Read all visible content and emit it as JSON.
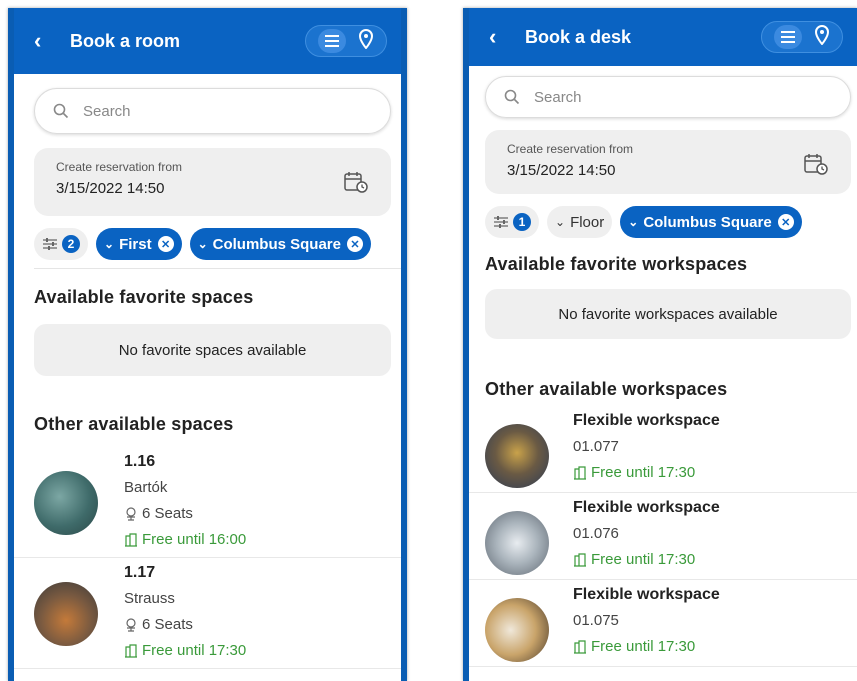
{
  "left": {
    "title": "Book a room",
    "search_placeholder": "Search",
    "date_label": "Create reservation from",
    "date_value": "3/15/2022 14:50",
    "filter_count": "2",
    "chips": [
      "First",
      "Columbus Square"
    ],
    "favorites_title": "Available favorite spaces",
    "favorites_empty": "No favorite spaces available",
    "other_title": "Other available spaces",
    "items": [
      {
        "name": "1.16",
        "sub": "Bartók",
        "seats": "6 Seats",
        "free": "Free until 16:00"
      },
      {
        "name": "1.17",
        "sub": "Strauss",
        "seats": "6 Seats",
        "free": "Free until 17:30"
      }
    ]
  },
  "right": {
    "title": "Book a desk",
    "search_placeholder": "Search",
    "date_label": "Create reservation from",
    "date_value": "3/15/2022 14:50",
    "filter_count": "1",
    "chips": [
      "Floor",
      "Columbus Square"
    ],
    "favorites_title": "Available favorite workspaces",
    "favorites_empty": "No favorite workspaces available",
    "other_title": "Other available workspaces",
    "items": [
      {
        "name": "Flexible workspace",
        "sub": "01.077",
        "free": "Free until 17:30"
      },
      {
        "name": "Flexible workspace",
        "sub": "01.076",
        "free": "Free until 17:30"
      },
      {
        "name": "Flexible workspace",
        "sub": "01.075",
        "free": "Free until 17:30"
      }
    ]
  },
  "colors": {
    "brand": "#0a63c2",
    "available": "#3a9a3a",
    "surface": "#efefef"
  }
}
